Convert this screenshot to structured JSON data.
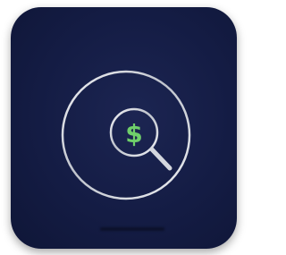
{
  "app_icon": {
    "symbol": "$",
    "icon_name": "search-dollar-icon",
    "colors": {
      "background": "#141c44",
      "ring": "#d4d7de",
      "symbol": "#6fcf6a",
      "outer_page": "#ffffff"
    }
  }
}
